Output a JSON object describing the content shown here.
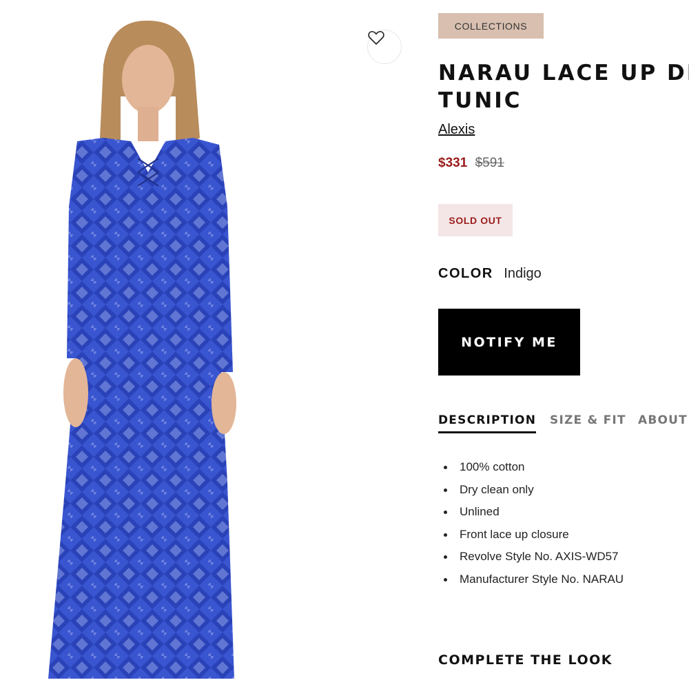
{
  "collections_badge": "COLLECTIONS",
  "product": {
    "title_line1": "NARAU LACE UP DR",
    "title_line2": "TUNIC",
    "brand": "Alexis",
    "sale_price": "$331",
    "original_price": "$591",
    "status": "SOLD OUT",
    "color_label": "COLOR",
    "color_value": "Indigo",
    "dress_color": "#3a55d0"
  },
  "actions": {
    "notify_label": "NOTIFY ME",
    "wishlist_icon": "heart-outline-icon"
  },
  "tabs": [
    {
      "label": "DESCRIPTION",
      "active": true
    },
    {
      "label": "SIZE & FIT",
      "active": false
    },
    {
      "label": "ABOUT",
      "active": false
    }
  ],
  "description": [
    "100% cotton",
    "Dry clean only",
    "Unlined",
    "Front lace up closure",
    "Revolve Style No. AXIS-WD57",
    "Manufacturer Style No. NARAU"
  ],
  "complete_the_look": "COMPLETE THE LOOK"
}
